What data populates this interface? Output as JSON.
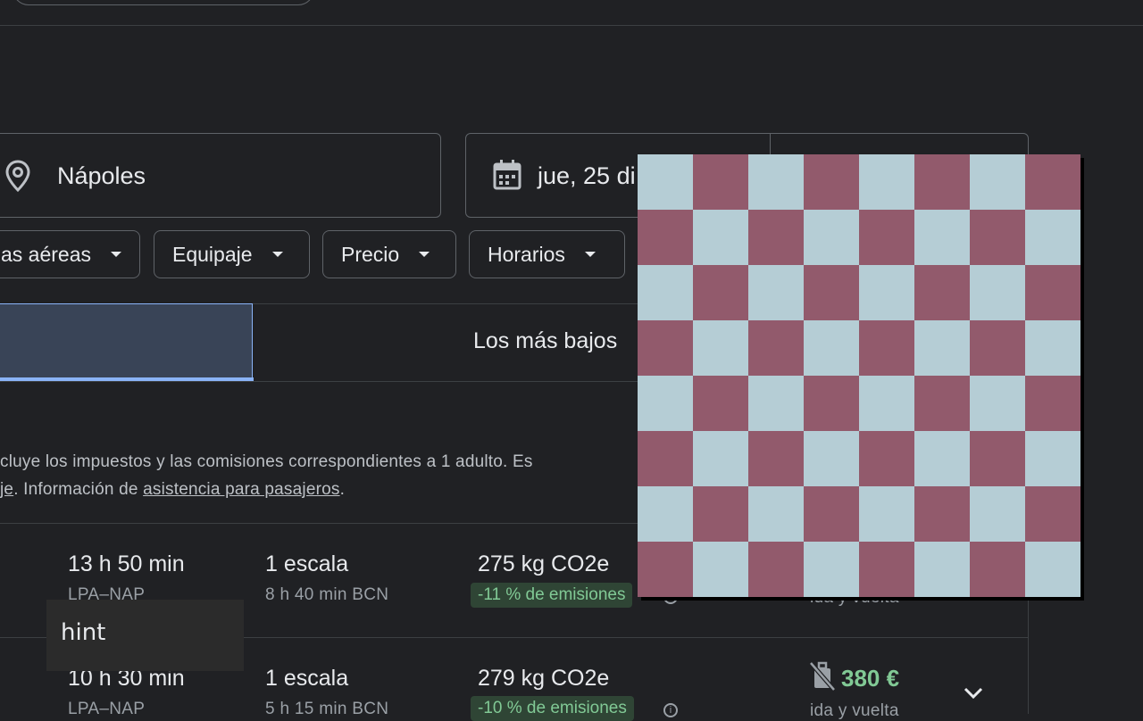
{
  "search": {
    "destination": "Nápoles",
    "date": "jue, 25 di"
  },
  "filters": {
    "airlines": "as aéreas",
    "bags": "Equipaje",
    "price": "Precio",
    "times": "Horarios"
  },
  "tabs": {
    "lowest": "Los más bajos"
  },
  "info": {
    "line1": "cluye los impuestos y las comisiones correspondientes a 1 adulto. Es",
    "line2_a": "je",
    "line2_b": ". Información de ",
    "line2_link": "asistencia para pasajeros",
    "line2_end": "."
  },
  "results": [
    {
      "duration": "13 h 50 min",
      "route": "LPA–NAP",
      "stops": "1 escala",
      "layover": "8 h 40 min BCN",
      "co2": "275 kg CO2e",
      "emissions": "-11 % de emisiones",
      "trip_type": "ida y vuelta"
    },
    {
      "duration": "10 h 30 min",
      "route": "LPA–NAP",
      "stops": "1 escala",
      "layover": "5 h 15 min BCN",
      "co2": "279 kg CO2e",
      "emissions": "-10 % de emisiones",
      "price": "380 €",
      "trip_type": "ida y vuelta"
    }
  ],
  "overlay": {
    "hint": "hint",
    "checker_colors": [
      "#b5cdd5",
      "#925a6c"
    ]
  },
  "icons": {
    "location": "location-pin-icon",
    "calendar": "calendar-icon",
    "no_bag": "no-carry-on-bag-icon",
    "expand": "chevron-down-icon",
    "info": "info-icon"
  },
  "colors": {
    "background": "#202124",
    "accent": "#8ab4f8",
    "price_green": "#81c995"
  }
}
